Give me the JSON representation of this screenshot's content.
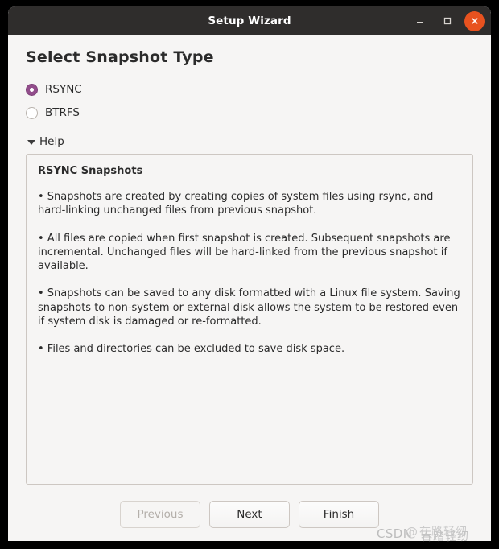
{
  "window": {
    "title": "Setup Wizard",
    "controls": {
      "minimize": "minimize-icon",
      "maximize": "maximize-icon",
      "close": "close-icon"
    },
    "accent_titlebar": "#2f2d2c",
    "accent_close": "#e8521f",
    "background": "#f6f5f4"
  },
  "page": {
    "title": "Select Snapshot Type"
  },
  "snapshot_type": {
    "selected": "RSYNC",
    "selected_color": "#924d8b",
    "options": [
      {
        "label": "RSYNC",
        "checked": true
      },
      {
        "label": "BTRFS",
        "checked": false
      }
    ]
  },
  "help_expander": {
    "label": "Help",
    "expanded": true,
    "icon": "triangle-down-icon"
  },
  "help": {
    "heading": "RSYNC Snapshots",
    "paragraphs": [
      "• Snapshots are created by creating copies of system files using rsync, and hard-linking unchanged files from previous snapshot.",
      "• All files are copied when first snapshot is created. Subsequent snapshots are incremental. Unchanged files will be hard-linked from the previous snapshot if available.",
      "• Snapshots can be saved to any disk formatted with a Linux file system. Saving snapshots to non-system or external disk allows the system to be restored even if system disk is damaged or re-formatted.",
      "• Files and directories can be excluded to save disk space."
    ]
  },
  "footer": {
    "previous_label": "Previous",
    "next_label": "Next",
    "finish_label": "Finish",
    "previous_enabled": false
  },
  "watermark": {
    "primary": "CSDN",
    "at": "@",
    "overlay_top": "在路轻纫",
    "overlay_bottom": "吞踏轻纫"
  }
}
